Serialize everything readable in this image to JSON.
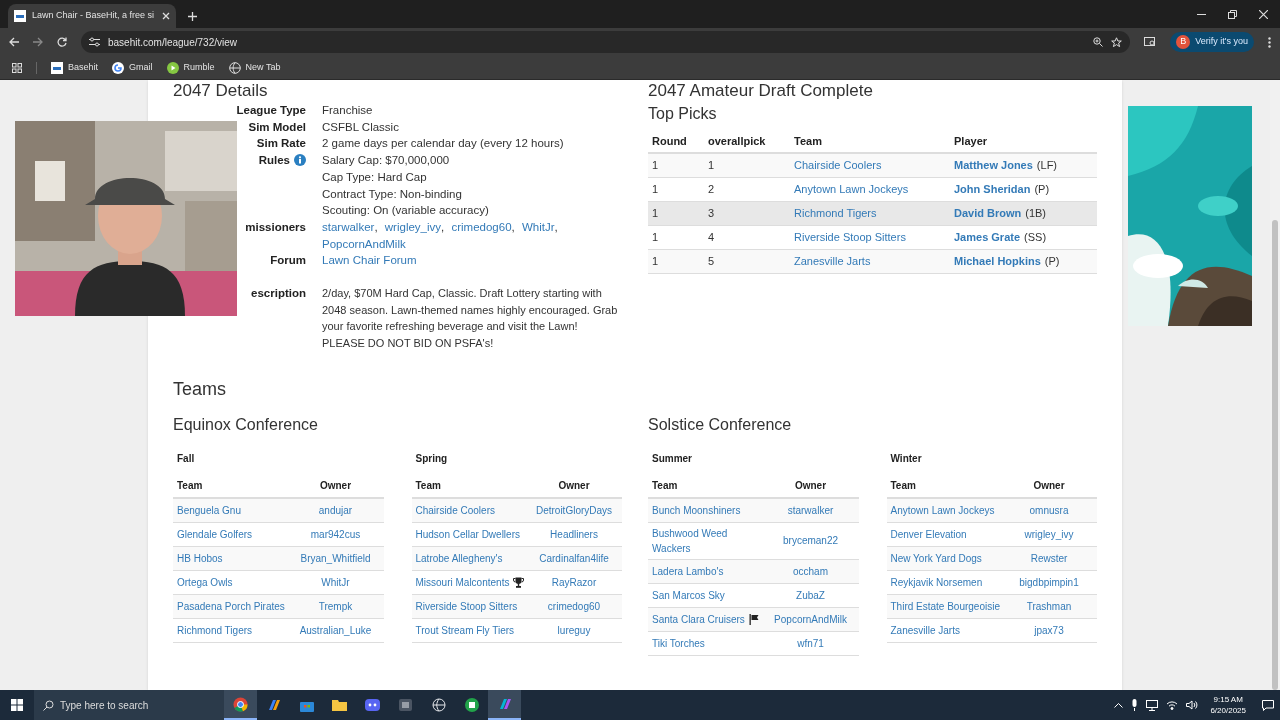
{
  "browser": {
    "tab_title": "Lawn Chair - BaseHit, a free si",
    "url": "basehit.com/league/732/view",
    "profile_button": "Verify it's you",
    "profile_initial": "B",
    "bookmarks": [
      {
        "label": "Basehit",
        "kind": "site"
      },
      {
        "label": "Gmail",
        "kind": "google"
      },
      {
        "label": "Rumble",
        "kind": "play"
      },
      {
        "label": "New Tab",
        "kind": "globe"
      }
    ]
  },
  "details": {
    "title": "2047 Details",
    "separator": ",",
    "rows": [
      {
        "label": "League Type",
        "kind": "text",
        "lines": [
          "Franchise"
        ]
      },
      {
        "label": "Sim Model",
        "kind": "text",
        "lines": [
          "CSFBL Classic"
        ]
      },
      {
        "label": "Sim Rate",
        "kind": "text",
        "lines": [
          "2 game days per calendar day (every 12 hours)"
        ]
      },
      {
        "label": "Rules",
        "kind": "text",
        "info": true,
        "lines": [
          "Salary Cap: $70,000,000",
          "Cap Type: Hard Cap",
          "Contract Type: Non-binding",
          "Scouting: On (variable accuracy)"
        ]
      },
      {
        "label": "missioners",
        "kind": "links",
        "lines": [
          "starwalker",
          "wrigley_ivy",
          "crimedog60",
          "WhitJr",
          "PopcornAndMilk"
        ]
      },
      {
        "label": "Forum",
        "kind": "links",
        "lines": [
          "Lawn Chair Forum"
        ]
      },
      {
        "label": "escription",
        "kind": "paragraph",
        "lines": [
          "2/day, $70M Hard Cap, Classic. Draft Lottery starting with 2048 season. Lawn-themed names highly encouraged. Grab your favorite refreshing beverage and visit the Lawn! PLEASE DO NOT BID ON PSFA's!"
        ]
      }
    ]
  },
  "draft": {
    "title": "2047 Amateur Draft Complete",
    "subtitle": "Top Picks",
    "columns": [
      "Round",
      "overallpick",
      "Team",
      "Player"
    ],
    "rows": [
      {
        "round": "1",
        "pick": "1",
        "team": "Chairside Coolers",
        "player": "Matthew Jones",
        "position": "(LF)",
        "hovered": false
      },
      {
        "round": "1",
        "pick": "2",
        "team": "Anytown Lawn Jockeys",
        "player": "John Sheridan",
        "position": "(P)",
        "hovered": false
      },
      {
        "round": "1",
        "pick": "3",
        "team": "Richmond Tigers",
        "player": "David Brown",
        "position": "(1B)",
        "hovered": true
      },
      {
        "round": "1",
        "pick": "4",
        "team": "Riverside Stoop Sitters",
        "player": "James Grate",
        "position": "(SS)",
        "hovered": false
      },
      {
        "round": "1",
        "pick": "5",
        "team": "Zanesville Jarts",
        "player": "Michael Hopkins",
        "position": "(P)",
        "hovered": false
      }
    ]
  },
  "teams": {
    "title": "Teams",
    "conferences": [
      {
        "name": "Equinox Conference",
        "divisions": [
          {
            "name": "Fall",
            "columns": [
              "Team",
              "Owner"
            ],
            "rows": [
              {
                "team": "Benguela Gnu",
                "owner": "andujar"
              },
              {
                "team": "Glendale Golfers",
                "owner": "mar942cus"
              },
              {
                "team": "HB Hobos",
                "owner": "Bryan_Whitfield"
              },
              {
                "team": "Ortega Owls",
                "owner": "WhitJr"
              },
              {
                "team": "Pasadena Porch Pirates",
                "owner": "Trempk"
              },
              {
                "team": "Richmond Tigers",
                "owner": "Australian_Luke"
              }
            ]
          },
          {
            "name": "Spring",
            "columns": [
              "Team",
              "Owner"
            ],
            "rows": [
              {
                "team": "Chairside Coolers",
                "owner": "DetroitGloryDays"
              },
              {
                "team": "Hudson Cellar Dwellers",
                "owner": "Headliners"
              },
              {
                "team": "Latrobe Allegheny's",
                "owner": "Cardinalfan4life"
              },
              {
                "team": "Missouri Malcontents",
                "owner": "RayRazor",
                "champion": true
              },
              {
                "team": "Riverside Stoop Sitters",
                "owner": "crimedog60"
              },
              {
                "team": "Trout Stream Fly Tiers",
                "owner": "lureguy"
              }
            ]
          }
        ]
      },
      {
        "name": "Solstice Conference",
        "divisions": [
          {
            "name": "Summer",
            "columns": [
              "Team",
              "Owner"
            ],
            "rows": [
              {
                "team": "Bunch Moonshiners",
                "owner": "starwalker"
              },
              {
                "team": "Bushwood Weed Wackers",
                "owner": "bryceman22"
              },
              {
                "team": "Ladera Lambo's",
                "owner": "occham"
              },
              {
                "team": "San Marcos Sky",
                "owner": "ZubaZ"
              },
              {
                "team": "Santa Clara Cruisers",
                "owner": "PopcornAndMilk",
                "flagged": true
              },
              {
                "team": "Tiki Torches",
                "owner": "wfn71"
              }
            ]
          },
          {
            "name": "Winter",
            "columns": [
              "Team",
              "Owner"
            ],
            "rows": [
              {
                "team": "Anytown Lawn Jockeys",
                "owner": "omnusra"
              },
              {
                "team": "Denver Elevation",
                "owner": "wrigley_ivy"
              },
              {
                "team": "New York Yard Dogs",
                "owner": "Rewster"
              },
              {
                "team": "Reykjavik Norsemen",
                "owner": "bigdbpimpin1"
              },
              {
                "team": "Third Estate Bourgeoisie",
                "owner": "Trashman"
              },
              {
                "team": "Zanesville Jarts",
                "owner": "jpax73"
              }
            ]
          }
        ]
      }
    ]
  },
  "taskbar": {
    "search_placeholder": "Type here to search",
    "time": "9:15 AM",
    "date": "6/20/2025"
  }
}
